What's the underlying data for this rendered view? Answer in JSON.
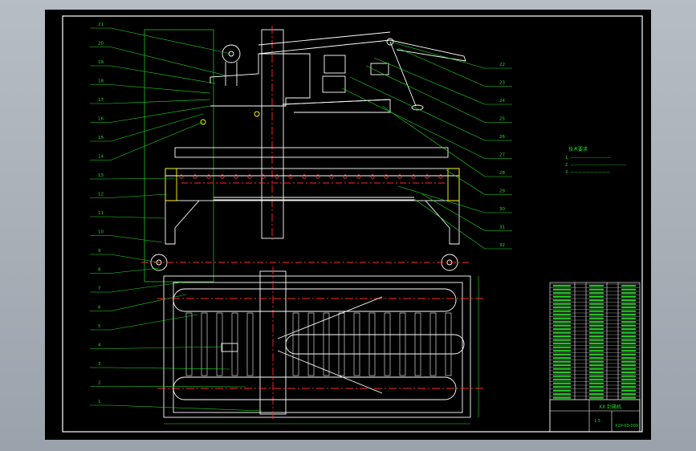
{
  "title_block": {
    "drawing_no": "X2P-00-000",
    "title": "XX 封箱机",
    "scale": "1:5"
  },
  "callouts": {
    "left": [
      "21",
      "20",
      "19",
      "18",
      "17",
      "16",
      "15",
      "14",
      "13",
      "12",
      "11",
      "10",
      "9",
      "8",
      "7",
      "6",
      "5",
      "4",
      "3",
      "2",
      "1"
    ],
    "right": [
      "22",
      "23",
      "24",
      "25",
      "26",
      "27",
      "28",
      "29",
      "30",
      "31",
      "32"
    ]
  },
  "notes": {
    "heading": "技术要求",
    "lines": [
      "1. ——————————",
      "2. ——————————————",
      "3. ——————————"
    ]
  },
  "colors": {
    "frame": "#ffffff",
    "outline": "#ffffff",
    "centerline": "#ff2a2a",
    "leader": "#22dd22",
    "hidden": "#e6e600",
    "sheet": "#000000"
  }
}
